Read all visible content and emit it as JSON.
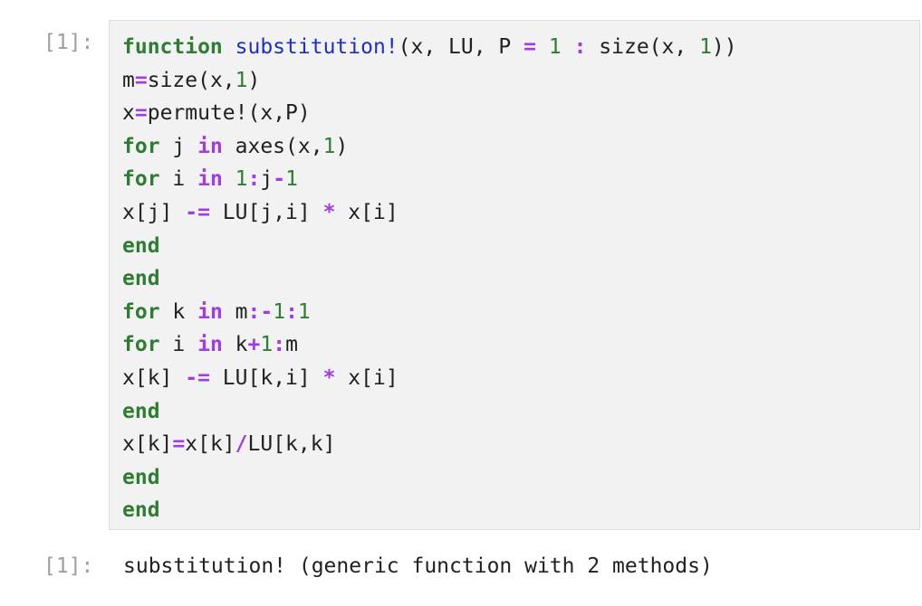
{
  "input_prompt": "[1]:",
  "output_prompt": "[1]:",
  "output_text": "substitution! (generic function with 2 methods)",
  "colors": {
    "keyword": "#2e7d32",
    "function_name": "#1e2fc8",
    "operator": "#a33ce0",
    "number": "#2e7d32",
    "text": "#212121",
    "prompt": "#9e9e9e",
    "cell_background": "#f2f2f2"
  },
  "code_lines": [
    [
      [
        "kw",
        "function"
      ],
      [
        "id",
        " "
      ],
      [
        "fn",
        "substitution!"
      ],
      [
        "punc",
        "(x, LU, P "
      ],
      [
        "op",
        "="
      ],
      [
        "id",
        " "
      ],
      [
        "num",
        "1"
      ],
      [
        "id",
        " "
      ],
      [
        "op",
        ":"
      ],
      [
        "id",
        " size(x, "
      ],
      [
        "num",
        "1"
      ],
      [
        "punc",
        "))"
      ]
    ],
    [
      [
        "id",
        "m"
      ],
      [
        "op",
        "="
      ],
      [
        "id",
        "size(x,"
      ],
      [
        "num",
        "1"
      ],
      [
        "punc",
        ")"
      ]
    ],
    [
      [
        "id",
        "x"
      ],
      [
        "op",
        "="
      ],
      [
        "id",
        "permute!(x,P)"
      ]
    ],
    [
      [
        "kw",
        "for"
      ],
      [
        "id",
        " j "
      ],
      [
        "op",
        "in"
      ],
      [
        "id",
        " axes(x,"
      ],
      [
        "num",
        "1"
      ],
      [
        "punc",
        ")"
      ]
    ],
    [
      [
        "kw",
        "for"
      ],
      [
        "id",
        " i "
      ],
      [
        "op",
        "in"
      ],
      [
        "id",
        " "
      ],
      [
        "num",
        "1"
      ],
      [
        "op",
        ":"
      ],
      [
        "id",
        "j"
      ],
      [
        "op",
        "-"
      ],
      [
        "num",
        "1"
      ]
    ],
    [
      [
        "id",
        "x[j] "
      ],
      [
        "op",
        "-="
      ],
      [
        "id",
        " LU[j,i] "
      ],
      [
        "op",
        "*"
      ],
      [
        "id",
        " x[i]"
      ]
    ],
    [
      [
        "kw",
        "end"
      ]
    ],
    [
      [
        "kw",
        "end"
      ]
    ],
    [
      [
        "kw",
        "for"
      ],
      [
        "id",
        " k "
      ],
      [
        "op",
        "in"
      ],
      [
        "id",
        " m"
      ],
      [
        "op",
        ":-"
      ],
      [
        "num",
        "1"
      ],
      [
        "op",
        ":"
      ],
      [
        "num",
        "1"
      ]
    ],
    [
      [
        "kw",
        "for"
      ],
      [
        "id",
        " i "
      ],
      [
        "op",
        "in"
      ],
      [
        "id",
        " k"
      ],
      [
        "op",
        "+"
      ],
      [
        "num",
        "1"
      ],
      [
        "op",
        ":"
      ],
      [
        "id",
        "m"
      ]
    ],
    [
      [
        "id",
        "x[k] "
      ],
      [
        "op",
        "-="
      ],
      [
        "id",
        " LU[k,i] "
      ],
      [
        "op",
        "*"
      ],
      [
        "id",
        " x[i]"
      ]
    ],
    [
      [
        "kw",
        "end"
      ]
    ],
    [
      [
        "id",
        "x[k]"
      ],
      [
        "op",
        "="
      ],
      [
        "id",
        "x[k]"
      ],
      [
        "op",
        "/"
      ],
      [
        "id",
        "LU[k,k]"
      ]
    ],
    [
      [
        "kw",
        "end"
      ]
    ],
    [
      [
        "kw",
        "end"
      ]
    ]
  ]
}
